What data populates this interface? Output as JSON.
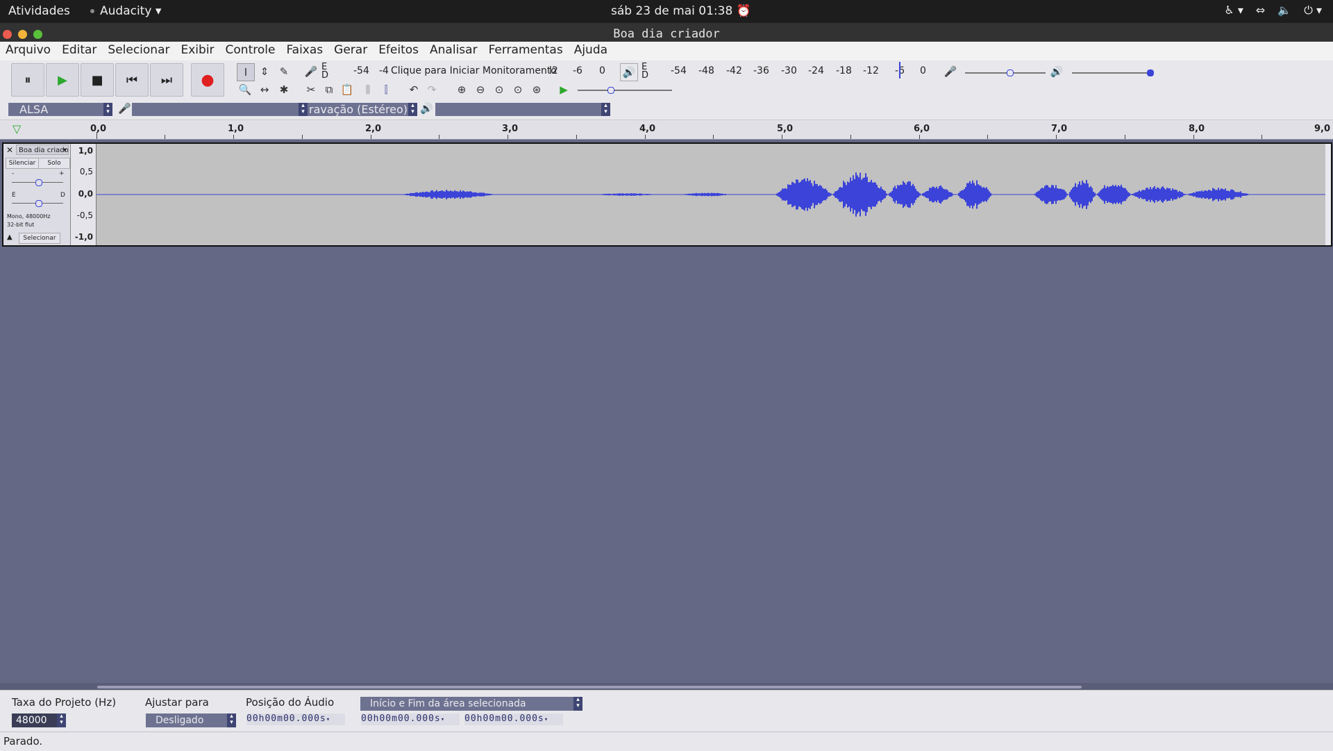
{
  "topbar": {
    "activities": "Atividades",
    "app_name": "Audacity",
    "clock": "sáb 23 de mai  01:38"
  },
  "window": {
    "title": "Boa dia criador"
  },
  "menu": [
    "Arquivo",
    "Editar",
    "Selecionar",
    "Exibir",
    "Controle",
    "Faixas",
    "Gerar",
    "Efeitos",
    "Analisar",
    "Ferramentas",
    "Ajuda"
  ],
  "meters": {
    "record_channels_top": "E",
    "record_channels_bottom": "D",
    "record_ticks": [
      "-54",
      "-4"
    ],
    "record_hint": "Clique para Iniciar Monitoramento",
    "record_ticks_end": [
      "l2",
      "-6",
      "0"
    ],
    "play_channels_top": "E",
    "play_channels_bottom": "D",
    "play_ticks": [
      "-54",
      "-48",
      "-42",
      "-36",
      "-30",
      "-24",
      "-18",
      "-12",
      "-6",
      "0"
    ]
  },
  "device": {
    "host": "ALSA",
    "recording_channels": "ravação (Estéreo)"
  },
  "ruler": {
    "labels": [
      "0,0",
      "1,0",
      "2,0",
      "3,0",
      "4,0",
      "5,0",
      "6,0",
      "7,0",
      "8,0",
      "9,0"
    ]
  },
  "track": {
    "name": "Boa dia criador",
    "mute": "Silenciar",
    "solo": "Solo",
    "gain_minus": "-",
    "gain_plus": "+",
    "pan_left": "E",
    "pan_right": "D",
    "info_line1": "Mono, 48000Hz",
    "info_line2": "32-bit flut",
    "select": "Selecionar",
    "scale": [
      "1,0",
      "0,5",
      "0,0",
      "-0,5",
      "-1,0"
    ]
  },
  "selection": {
    "project_rate_label": "Taxa do Projeto (Hz)",
    "project_rate": "48000",
    "snap_label": "Ajustar para",
    "snap_value": "Desligado",
    "position_label": "Posição do Áudio",
    "range_mode": "Início e Fim da área selecionada",
    "time_position": "00h00m00.000s",
    "time_start": "00h00m00.000s",
    "time_end": "00h00m00.000s"
  },
  "status": "Parado.",
  "colors": {
    "background": "#646884",
    "waveform": "#3b43d8",
    "record": "#e02020",
    "play": "#2ea82e"
  }
}
